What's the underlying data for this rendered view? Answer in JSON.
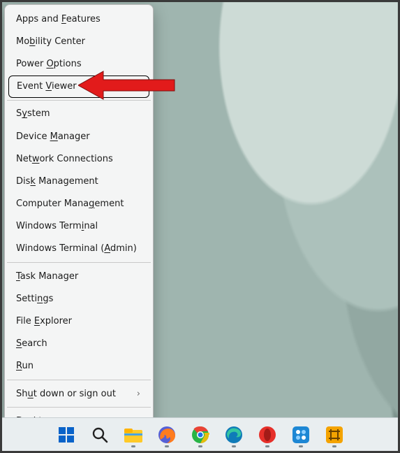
{
  "menu": {
    "items": [
      {
        "pre": "Apps and ",
        "ak": "F",
        "post": "eatures",
        "sub": false
      },
      {
        "pre": "Mo",
        "ak": "b",
        "post": "ility Center",
        "sub": false
      },
      {
        "pre": "Power ",
        "ak": "O",
        "post": "ptions",
        "sub": false
      },
      {
        "pre": "Event ",
        "ak": "V",
        "post": "iewer",
        "sub": false,
        "focused": true
      },
      "---",
      {
        "pre": "S",
        "ak": "y",
        "post": "stem",
        "sub": false
      },
      {
        "pre": "Device ",
        "ak": "M",
        "post": "anager",
        "sub": false
      },
      {
        "pre": "Net",
        "ak": "w",
        "post": "ork Connections",
        "sub": false
      },
      {
        "pre": "Dis",
        "ak": "k",
        "post": " Management",
        "sub": false
      },
      {
        "pre": "Computer Mana",
        "ak": "g",
        "post": "ement",
        "sub": false
      },
      {
        "pre": "Windows Term",
        "ak": "i",
        "post": "nal",
        "sub": false
      },
      {
        "pre": "Windows Terminal (",
        "ak": "A",
        "post": "dmin)",
        "sub": false
      },
      "---",
      {
        "pre": "",
        "ak": "T",
        "post": "ask Manager",
        "sub": false
      },
      {
        "pre": "Setti",
        "ak": "n",
        "post": "gs",
        "sub": false
      },
      {
        "pre": "File ",
        "ak": "E",
        "post": "xplorer",
        "sub": false
      },
      {
        "pre": "",
        "ak": "S",
        "post": "earch",
        "sub": false
      },
      {
        "pre": "",
        "ak": "R",
        "post": "un",
        "sub": false
      },
      "---",
      {
        "pre": "Sh",
        "ak": "u",
        "post": "t down or sign out",
        "sub": true
      },
      "---",
      {
        "pre": "",
        "ak": "D",
        "post": "esktop",
        "sub": false
      }
    ]
  },
  "taskbar": {
    "apps": [
      {
        "name": "start",
        "title": "Start"
      },
      {
        "name": "search",
        "title": "Search"
      },
      {
        "name": "file-explorer",
        "title": "File Explorer"
      },
      {
        "name": "firefox",
        "title": "Firefox"
      },
      {
        "name": "chrome",
        "title": "Google Chrome"
      },
      {
        "name": "edge",
        "title": "Microsoft Edge"
      },
      {
        "name": "opera",
        "title": "Opera"
      },
      {
        "name": "app-generic",
        "title": "App"
      },
      {
        "name": "app-gold",
        "title": "App"
      }
    ]
  },
  "chevron_glyph": "›"
}
